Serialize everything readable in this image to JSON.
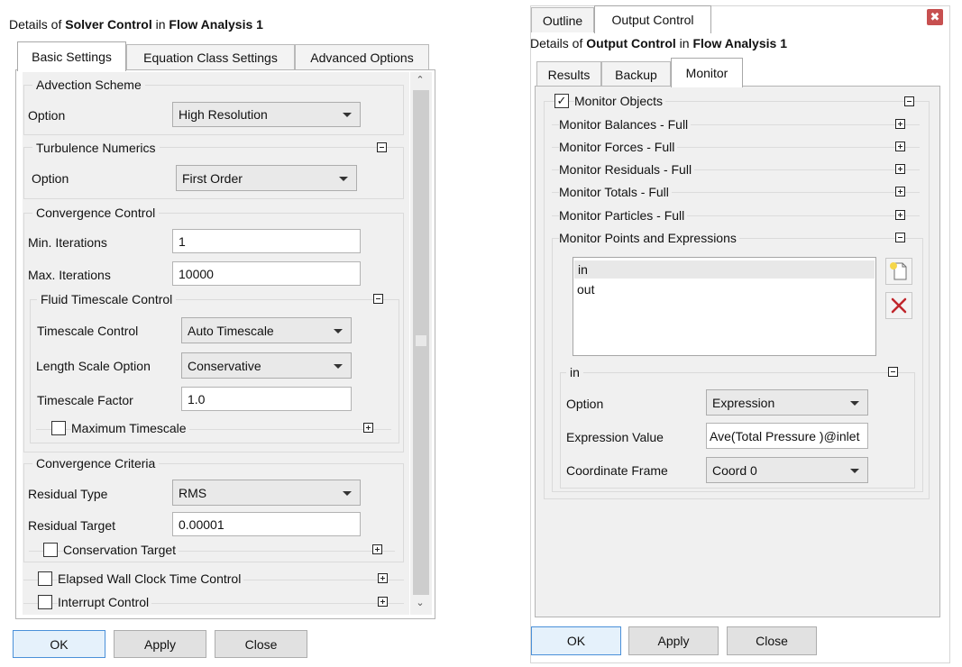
{
  "left": {
    "title": {
      "prefix": "Details of ",
      "bold1": "Solver Control",
      "mid": " in ",
      "bold2": "Flow Analysis 1"
    },
    "tabs": [
      "Basic Settings",
      "Equation Class Settings",
      "Advanced Options"
    ],
    "advection": {
      "legend": "Advection Scheme",
      "option_label": "Option",
      "option_value": "High Resolution"
    },
    "turbulence": {
      "legend": "Turbulence Numerics",
      "option_label": "Option",
      "option_value": "First Order"
    },
    "convergence": {
      "legend": "Convergence Control",
      "min_label": "Min. Iterations",
      "min_value": "1",
      "max_label": "Max. Iterations",
      "max_value": "10000",
      "fluid": {
        "legend": "Fluid Timescale Control",
        "timescale_label": "Timescale Control",
        "timescale_value": "Auto Timescale",
        "length_label": "Length Scale Option",
        "length_value": "Conservative",
        "factor_label": "Timescale Factor",
        "factor_value": "1.0",
        "maxts_label": "Maximum Timescale"
      }
    },
    "criteria": {
      "legend": "Convergence Criteria",
      "type_label": "Residual Type",
      "type_value": "RMS",
      "target_label": "Residual Target",
      "target_value": "0.00001",
      "cons_label": "Conservation Target"
    },
    "elapsed_label": "Elapsed Wall Clock Time Control",
    "interrupt_label": "Interrupt Control",
    "buttons": {
      "ok": "OK",
      "apply": "Apply",
      "close": "Close"
    }
  },
  "right": {
    "top_tabs": [
      "Outline",
      "Output Control"
    ],
    "title": {
      "prefix": "Details of ",
      "bold1": "Output Control",
      "mid": " in ",
      "bold2": "Flow Analysis 1"
    },
    "tabs": [
      "Results",
      "Backup",
      "Monitor"
    ],
    "monitor_objects_label": "Monitor Objects",
    "monitor_rows": [
      "Monitor Balances - Full",
      "Monitor Forces - Full",
      "Monitor Residuals - Full",
      "Monitor Totals - Full",
      "Monitor Particles - Full"
    ],
    "points_label": "Monitor Points and Expressions",
    "list_items": [
      "in",
      "out"
    ],
    "sub": {
      "legend": "in",
      "option_label": "Option",
      "option_value": "Expression",
      "expr_label": "Expression Value",
      "expr_value": "Ave(Total Pressure )@inlet",
      "frame_label": "Coordinate Frame",
      "frame_value": "Coord 0"
    },
    "buttons": {
      "ok": "OK",
      "apply": "Apply",
      "close": "Close"
    }
  }
}
